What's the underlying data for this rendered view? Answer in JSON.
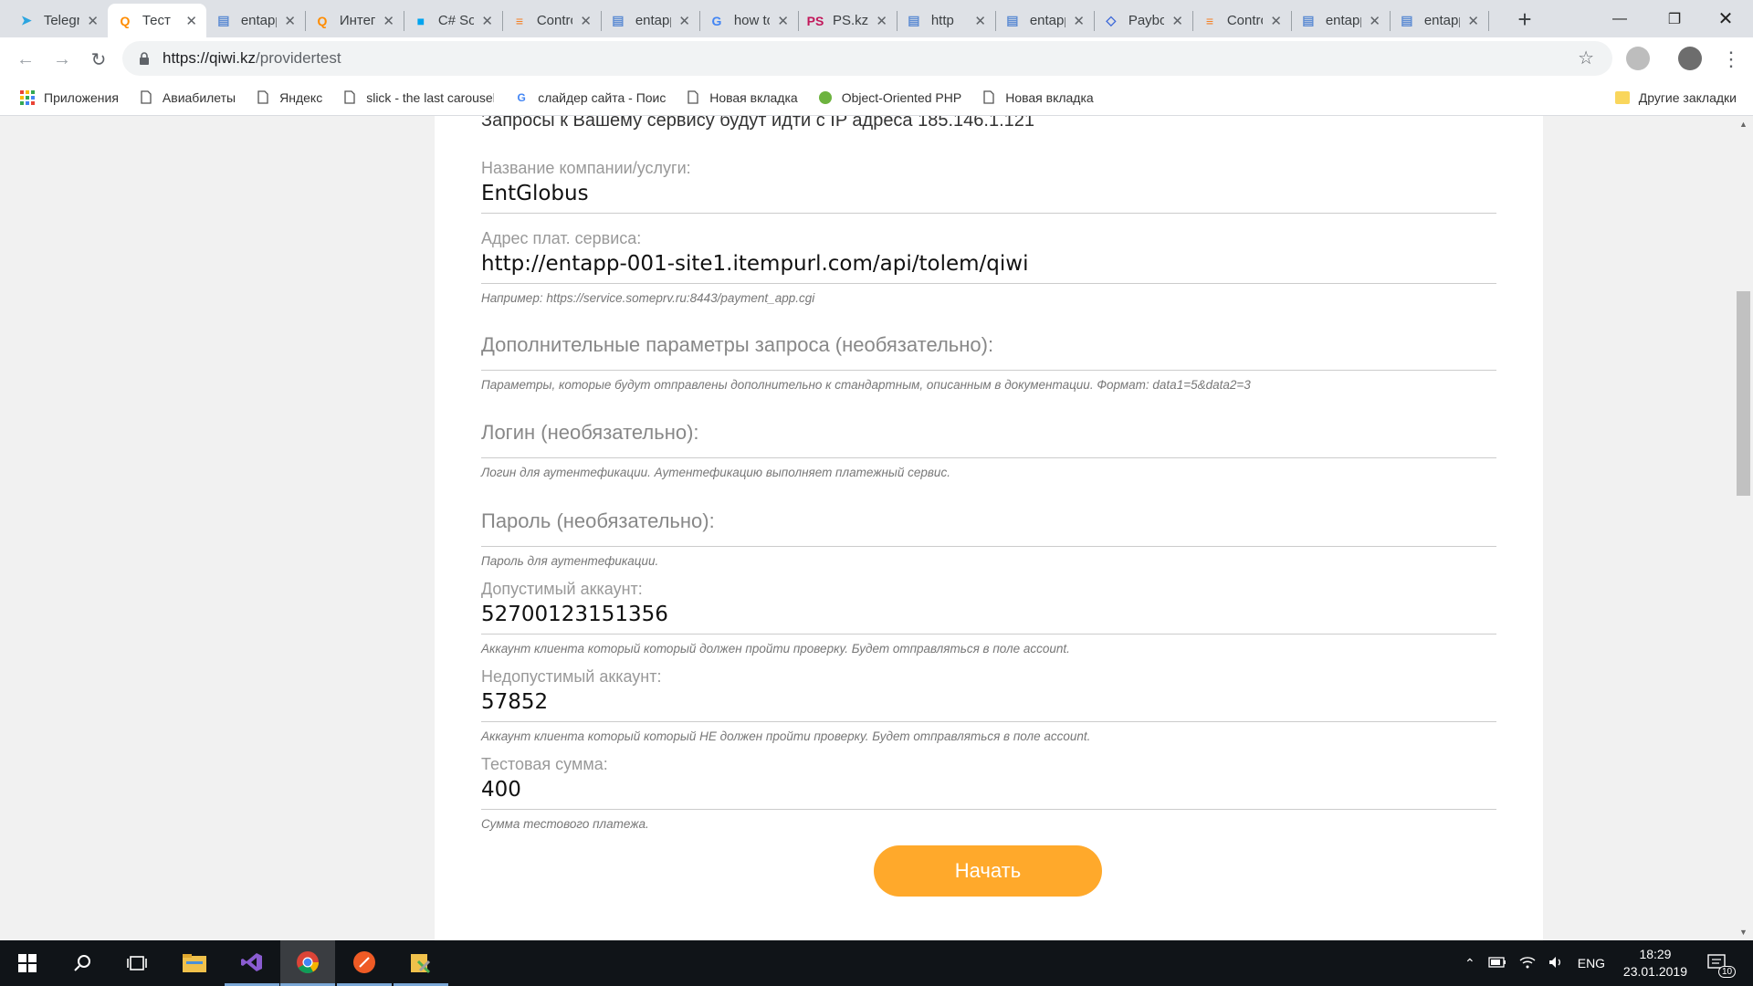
{
  "tabs": [
    {
      "title": "Telegram",
      "icon": "telegram-icon",
      "color": "#2ca5e0"
    },
    {
      "title": "Тест",
      "icon": "qiwi-icon",
      "color": "#ff8c00",
      "active": true
    },
    {
      "title": "entapp",
      "icon": "doc-icon",
      "color": "#5f8dd3"
    },
    {
      "title": "Интеграция",
      "icon": "qiwi-icon",
      "color": "#ff8c00"
    },
    {
      "title": "C# Sort",
      "icon": "windows-icon",
      "color": "#00a4ef"
    },
    {
      "title": "Controller",
      "icon": "stackoverflow-icon",
      "color": "#f48024"
    },
    {
      "title": "entapp",
      "icon": "doc-icon",
      "color": "#5f8dd3"
    },
    {
      "title": "how to",
      "icon": "google-icon",
      "color": "#4285f4"
    },
    {
      "title": "PS.kz",
      "icon": "ps-icon",
      "color": "#c2185b"
    },
    {
      "title": "http",
      "icon": "doc-icon",
      "color": "#5f8dd3"
    },
    {
      "title": "entapp",
      "icon": "doc-icon",
      "color": "#5f8dd3"
    },
    {
      "title": "Paybox",
      "icon": "paybox-icon",
      "color": "#3f6ad8"
    },
    {
      "title": "Controller",
      "icon": "stackoverflow-icon",
      "color": "#f48024"
    },
    {
      "title": "entapp",
      "icon": "doc-icon",
      "color": "#5f8dd3"
    },
    {
      "title": "entapp",
      "icon": "doc-icon",
      "color": "#5f8dd3"
    }
  ],
  "address": {
    "host": "https://qiwi.kz",
    "path": "/providertest"
  },
  "bookmarks": [
    {
      "label": "Приложения",
      "icon": "apps-grid-icon"
    },
    {
      "label": "Авиабилеты",
      "icon": "page-icon"
    },
    {
      "label": "Яндекс",
      "icon": "page-icon"
    },
    {
      "label": "slick - the last carousel",
      "icon": "page-icon"
    },
    {
      "label": "слайдер сайта - Поиск",
      "icon": "google-icon"
    },
    {
      "label": "Новая вкладка",
      "icon": "page-icon"
    },
    {
      "label": "Object-Oriented PHP",
      "icon": "leaf-icon"
    },
    {
      "label": "Новая вкладка",
      "icon": "page-icon"
    }
  ],
  "other_bookmarks": "Другие закладки",
  "form": {
    "intro": "Запросы к Вашему сервису будут идти с IP адреса 185.146.1.121",
    "company": {
      "label": "Название компании/услуги:",
      "value": "EntGlobus"
    },
    "service_url": {
      "label": "Адрес плат. сервиса:",
      "value": "http://entapp-001-site1.itempurl.com/api/tolem/qiwi",
      "hint": "Например: https://service.someprv.ru:8443/payment_app.cgi"
    },
    "extra_params": {
      "placeholder": "Дополнительные параметры запроса (необязательно):",
      "hint": "Параметры, которые будут отправлены дополнительно к стандартным, описанным в документации. Формат: data1=5&data2=3"
    },
    "login": {
      "placeholder": "Логин (необязательно):",
      "hint": "Логин для аутентефикации. Аутентефикацию выполняет платежный сервис."
    },
    "password": {
      "placeholder": "Пароль (необязательно):",
      "hint": "Пароль для аутентефикации."
    },
    "valid_account": {
      "label": "Допустимый аккаунт:",
      "value": "52700123151356",
      "hint": "Аккаунт клиента который который должен пройти проверку. Будет отправляться в поле account."
    },
    "invalid_account": {
      "label": "Недопустимый аккаунт:",
      "value": "57852",
      "hint": "Аккаунт клиента который который НЕ должен пройти проверку. Будет отправляться в поле account."
    },
    "test_amount": {
      "label": "Тестовая сумма:",
      "value": "400",
      "hint": "Сумма тестового платежа."
    },
    "start_label": "Начать"
  },
  "taskbar": {
    "lang": "ENG",
    "time": "18:29",
    "date": "23.01.2019",
    "notifications": "10"
  },
  "colors": {
    "accent": "#ffa92b",
    "taskbar": "#101418"
  }
}
